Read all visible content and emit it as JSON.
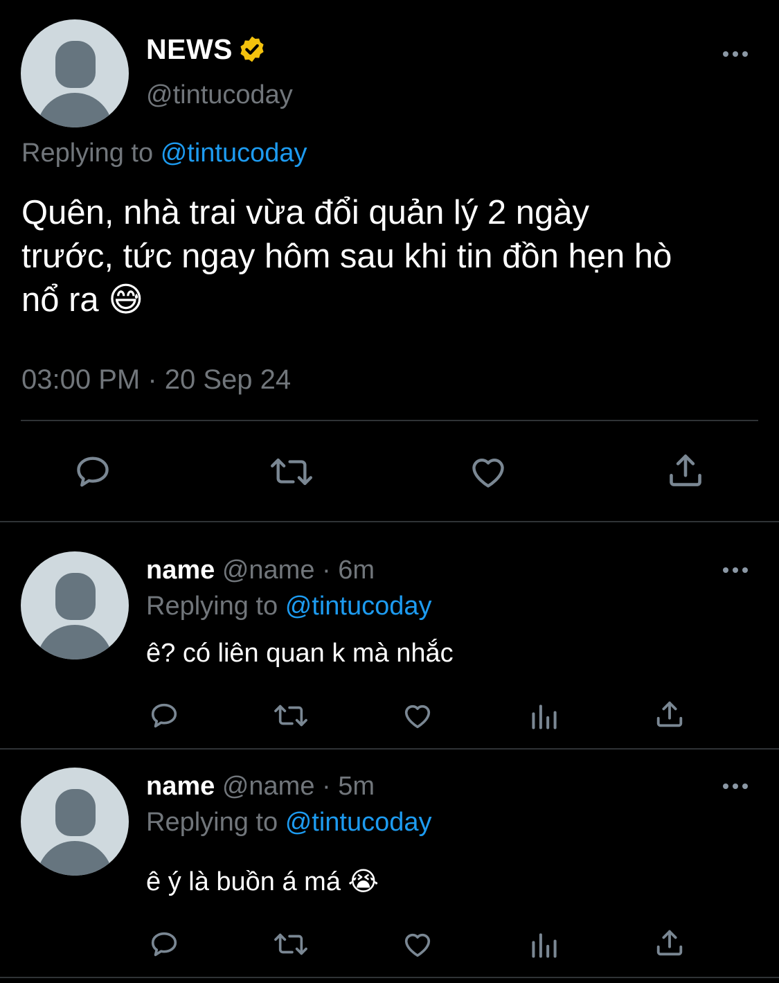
{
  "main_tweet": {
    "display_name": "NEWS",
    "verified_icon": "verified-badge-icon",
    "handle": "@tintucoday",
    "replying_prefix": "Replying to",
    "replying_handle": "@tintucoday",
    "text_line1": "Quên, nhà trai vừa đổi quản lý 2 ngày",
    "text_line2": "trước, tức ngay hôm sau khi tin đồn hẹn hò",
    "text_line3": "nổ ra 😅",
    "timestamp": "03:00 PM · 20 Sep 24"
  },
  "replies": [
    {
      "display_name": "name",
      "handle": "@name",
      "time": "· 6m",
      "replying_prefix": "Replying to",
      "replying_handle": "@tintucoday",
      "text": "ê? có liên quan k mà nhắc"
    },
    {
      "display_name": "name",
      "handle": "@name",
      "time": "· 5m",
      "replying_prefix": "Replying to",
      "replying_handle": "@tintucoday",
      "text": "ê ý là buồn á má 😭"
    }
  ],
  "icons": {
    "reply": "reply-icon",
    "retweet": "retweet-icon",
    "like": "heart-icon",
    "views": "views-icon",
    "share": "share-icon",
    "more": "more-icon"
  },
  "colors": {
    "background": "#000000",
    "text": "#e7e9ea",
    "secondary": "#71767b",
    "link": "#1d9bf0",
    "verified": "#f4c20d",
    "icon": "#7a8793"
  }
}
